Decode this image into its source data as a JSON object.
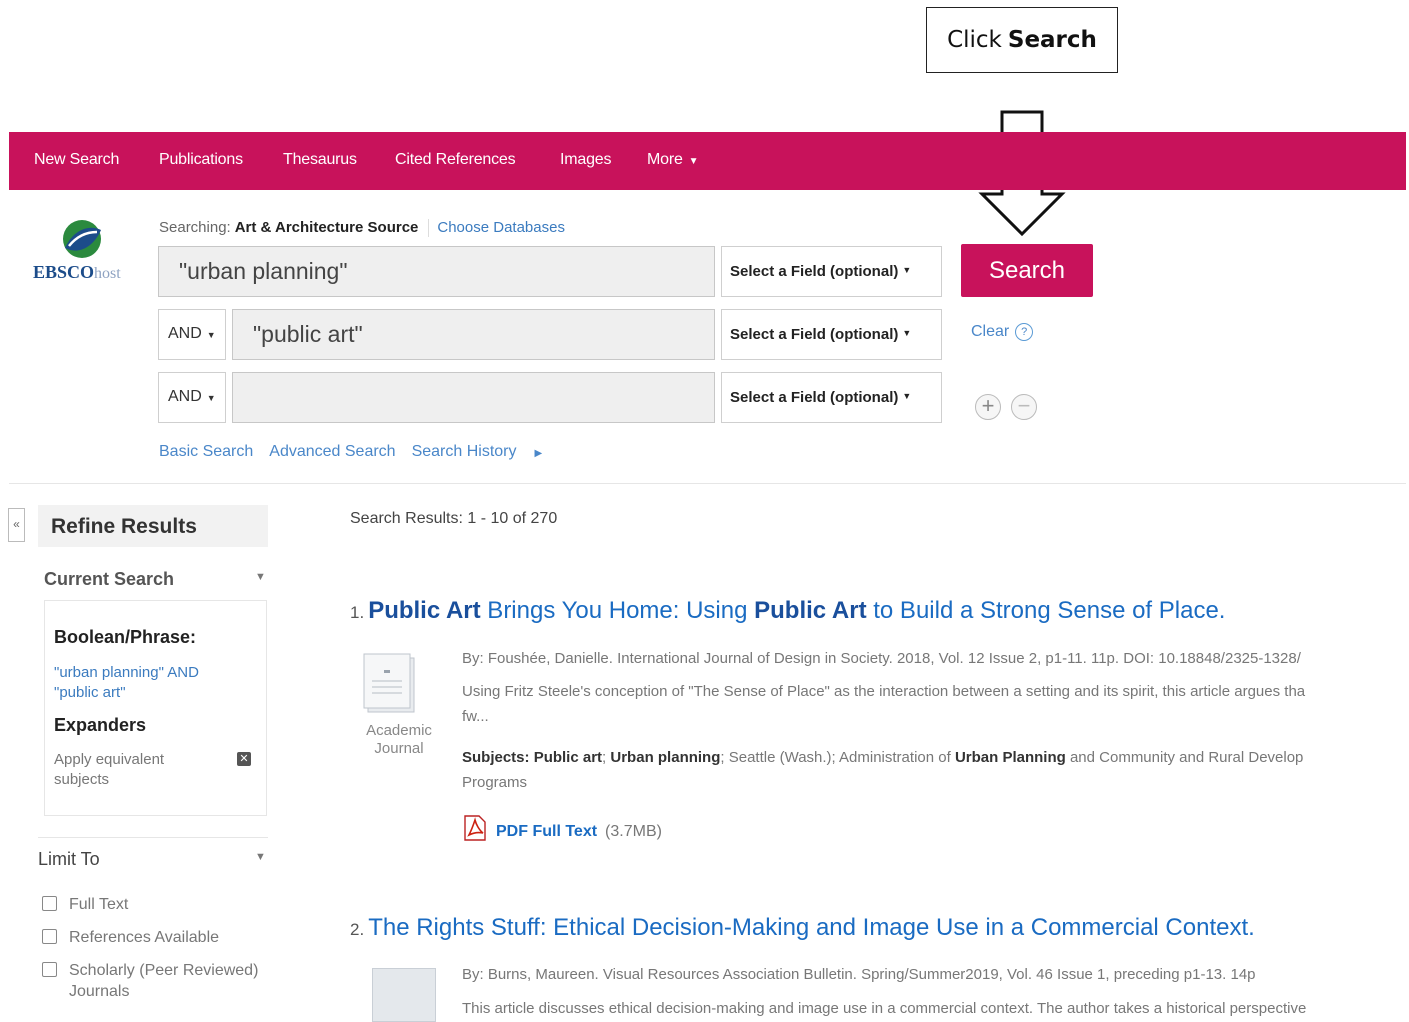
{
  "callout": {
    "prefix": "Click",
    "bold": "Search"
  },
  "nav": {
    "items": [
      "New Search",
      "Publications",
      "Thesaurus",
      "Cited References",
      "Images",
      "More"
    ]
  },
  "logo": {
    "brand": "EBSCO",
    "suffix": "host"
  },
  "search": {
    "searching_label": "Searching:",
    "database": "Art & Architecture Source",
    "choose_databases": "Choose Databases",
    "rows": [
      {
        "operator": "",
        "value": "\"urban planning\"",
        "field": "Select a Field (optional)"
      },
      {
        "operator": "AND",
        "value": "\"public art\"",
        "field": "Select a Field (optional)"
      },
      {
        "operator": "AND",
        "value": "",
        "field": "Select a Field (optional)"
      }
    ],
    "button": "Search",
    "clear": "Clear",
    "links": [
      "Basic Search",
      "Advanced Search",
      "Search History"
    ]
  },
  "sidebar": {
    "refine_title": "Refine Results",
    "current_search": "Current Search",
    "boolean_label": "Boolean/Phrase:",
    "boolean_value_1": "\"urban planning\" AND",
    "boolean_value_2": "\"public art\"",
    "expanders_label": "Expanders",
    "expander_1": "Apply equivalent",
    "expander_2": "subjects",
    "limit_to": "Limit To",
    "limits": [
      "Full Text",
      "References Available",
      "Scholarly (Peer Reviewed)"
    ],
    "limit_3_line2": "Journals"
  },
  "results": {
    "count": "Search Results: 1 - 10 of 270",
    "items": [
      {
        "num": "1.",
        "title_b1": "Public Art",
        "title_t1": " Brings You Home: Using ",
        "title_b2": "Public Art",
        "title_t2": " to Build a Strong Sense of Place.",
        "byline": "By: Foushée, Danielle. International Journal of Design in Society. 2018, Vol. 12 Issue 2, p1-11. 11p. DOI: 10.18848/2325-1328/",
        "abstract_1": "Using Fritz Steele's conception of \"The Sense of Place\" as the interaction between a setting and its spirit, this article argues tha",
        "abstract_2": "fw...",
        "subjects_label": "Subjects:",
        "subj_b1": "Public art",
        "subj_b2": "Urban planning",
        "subj_t1": "; Seattle (Wash.); Administration of ",
        "subj_b3": "Urban Planning",
        "subj_t2": " and Community and Rural Develop",
        "subj_line2": "Programs",
        "pub_type_1": "Academic",
        "pub_type_2": "Journal",
        "pdf_label": "PDF Full Text",
        "pdf_size": "(3.7MB)"
      },
      {
        "num": "2.",
        "title": "The Rights Stuff: Ethical Decision-Making and Image Use in a Commercial Context.",
        "byline": "By: Burns, Maureen. Visual Resources Association Bulletin. Spring/Summer2019, Vol. 46 Issue 1, preceding p1-13. 14p",
        "abstract_1": "This article discusses ethical decision-making and image use in a commercial context. The author takes a historical perspective"
      }
    ]
  },
  "colors": {
    "brand": "#c8125b",
    "link": "#1a6bc2"
  }
}
